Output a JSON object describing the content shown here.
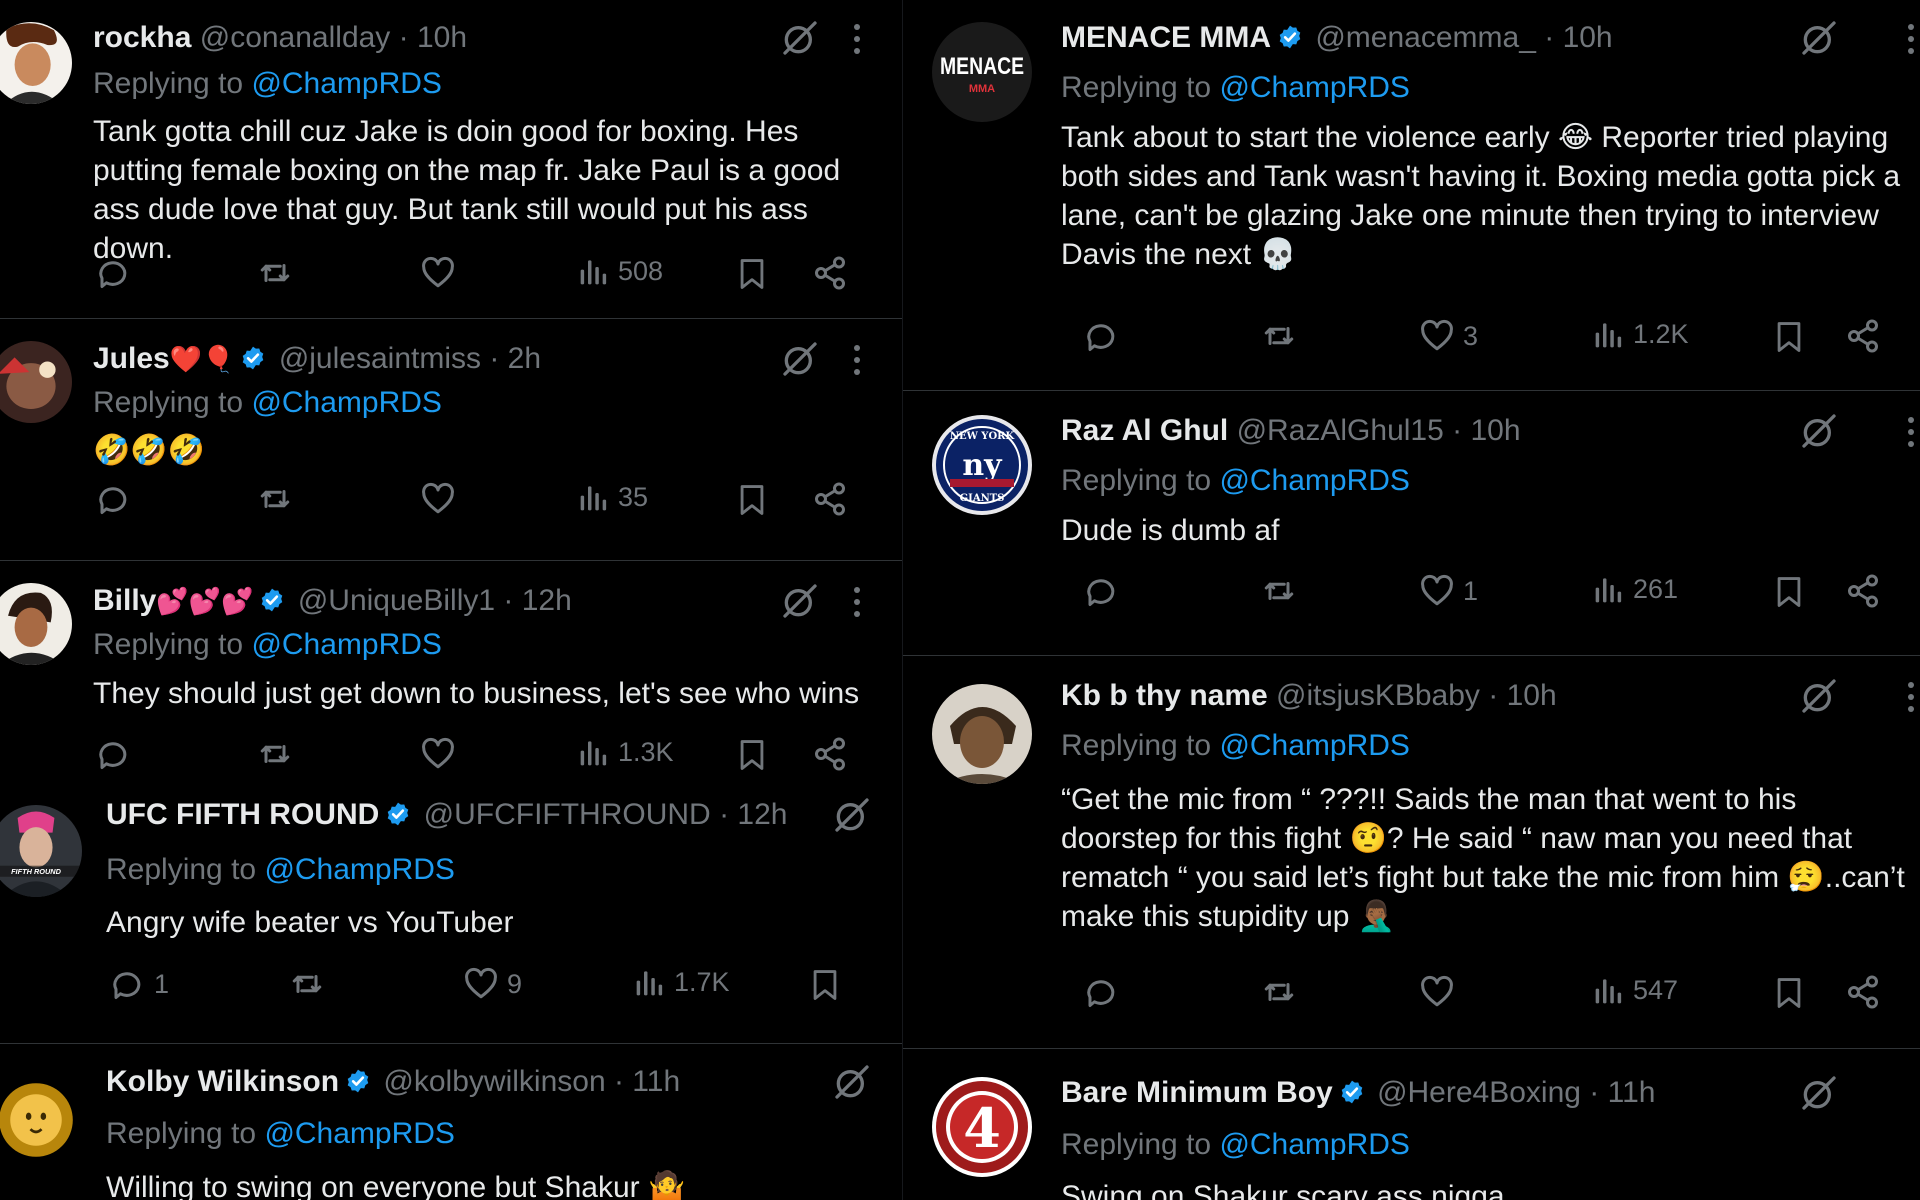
{
  "left_tweets": [
    {
      "name": "rockha",
      "name_emoji": "",
      "verified": false,
      "handle": "@conanallday",
      "time": "10h",
      "reply_prefix": "Replying to",
      "reply_to": "@ChampRDS",
      "text": "Tank gotta chill cuz Jake is doin good for boxing. Hes putting female boxing on the map fr. Jake Paul is a good ass dude love that guy. But tank still would put his ass down.",
      "replies": "",
      "reposts": "",
      "likes": "",
      "views": "508"
    },
    {
      "name": "Jules",
      "name_emoji": "❤️🎈",
      "verified": true,
      "handle": "@julesaintmiss",
      "time": "2h",
      "reply_prefix": "Replying to",
      "reply_to": "@ChampRDS",
      "text": "🤣🤣🤣",
      "replies": "",
      "reposts": "",
      "likes": "",
      "views": "35"
    },
    {
      "name": "Billy",
      "name_emoji": "💕💕💕",
      "verified": true,
      "handle": "@UniqueBilly1",
      "time": "12h",
      "reply_prefix": "Replying to",
      "reply_to": "@ChampRDS",
      "text": "They should just get down to business, let's see who wins",
      "replies": "",
      "reposts": "",
      "likes": "",
      "views": "1.3K"
    },
    {
      "name": "UFC FIFTH ROUND",
      "name_emoji": "",
      "verified": true,
      "handle": "@UFCFIFTHROUND",
      "time": "12h",
      "reply_prefix": "Replying to",
      "reply_to": "@ChampRDS",
      "text": "Angry wife beater vs YouTuber",
      "replies": "1",
      "reposts": "",
      "likes": "9",
      "views": "1.7K",
      "avatar_text": "FIFTH ROUND"
    },
    {
      "name": "Kolby Wilkinson",
      "name_emoji": "",
      "verified": true,
      "handle": "@kolbywilkinson",
      "time": "11h",
      "reply_prefix": "Replying to",
      "reply_to": "@ChampRDS",
      "text": "Willing to swing on everyone but Shakur 🤷"
    }
  ],
  "right_tweets": [
    {
      "name": "MENACE MMA",
      "name_emoji": "",
      "verified": true,
      "handle": "@menacemma_",
      "time": "10h",
      "reply_prefix": "Replying to",
      "reply_to": "@ChampRDS",
      "text": "Tank about to start the violence early 😂 Reporter tried playing both sides and Tank wasn't having it. Boxing media gotta pick a lane, can't be glazing Jake one minute then trying to interview Davis the next 💀",
      "replies": "",
      "reposts": "",
      "likes": "3",
      "views": "1.2K",
      "avatar_text": "MENACE",
      "avatar_sub": "MMA"
    },
    {
      "name": "Raz Al Ghul",
      "name_emoji": "",
      "verified": false,
      "handle": "@RazAlGhul15",
      "time": "10h",
      "reply_prefix": "Replying to",
      "reply_to": "@ChampRDS",
      "text": "Dude is dumb af",
      "replies": "",
      "reposts": "",
      "likes": "1",
      "views": "261",
      "avatar_text": "ny",
      "avatar_top": "NEW YORK",
      "avatar_bottom": "GIANTS"
    },
    {
      "name": "Kb b thy name",
      "name_emoji": "",
      "verified": false,
      "handle": "@itsjusKBbaby",
      "time": "10h",
      "reply_prefix": "Replying to",
      "reply_to": "@ChampRDS",
      "text": "“Get the mic from “ ???!! Saids the man that went to his doorstep for this fight 🤨? He said “ naw man you need that rematch “ you said let’s fight but take the mic from him 😮‍💨..can’t make this stupidity up 🤦🏾‍♂️",
      "replies": "",
      "reposts": "",
      "likes": "",
      "views": "547"
    },
    {
      "name": "Bare Minimum Boy",
      "name_emoji": "",
      "verified": true,
      "handle": "@Here4Boxing",
      "time": "11h",
      "reply_prefix": "Replying to",
      "reply_to": "@ChampRDS",
      "text": "Swing on Shakur scary ass nigga",
      "avatar_text": "4"
    }
  ],
  "separator": "·",
  "colors": {
    "background": "#000000",
    "text": "#e7e9ea",
    "muted": "#71767b",
    "accent": "#1d9bf0",
    "divider": "#2f3336"
  },
  "icons": {
    "reply": "reply-icon",
    "repost": "repost-icon",
    "like": "heart-icon",
    "views": "views-chart-icon",
    "bookmark": "bookmark-icon",
    "share": "share-icon",
    "grok": "grok-icon",
    "more": "more-dots-icon",
    "verified": "verified-badge-icon"
  }
}
